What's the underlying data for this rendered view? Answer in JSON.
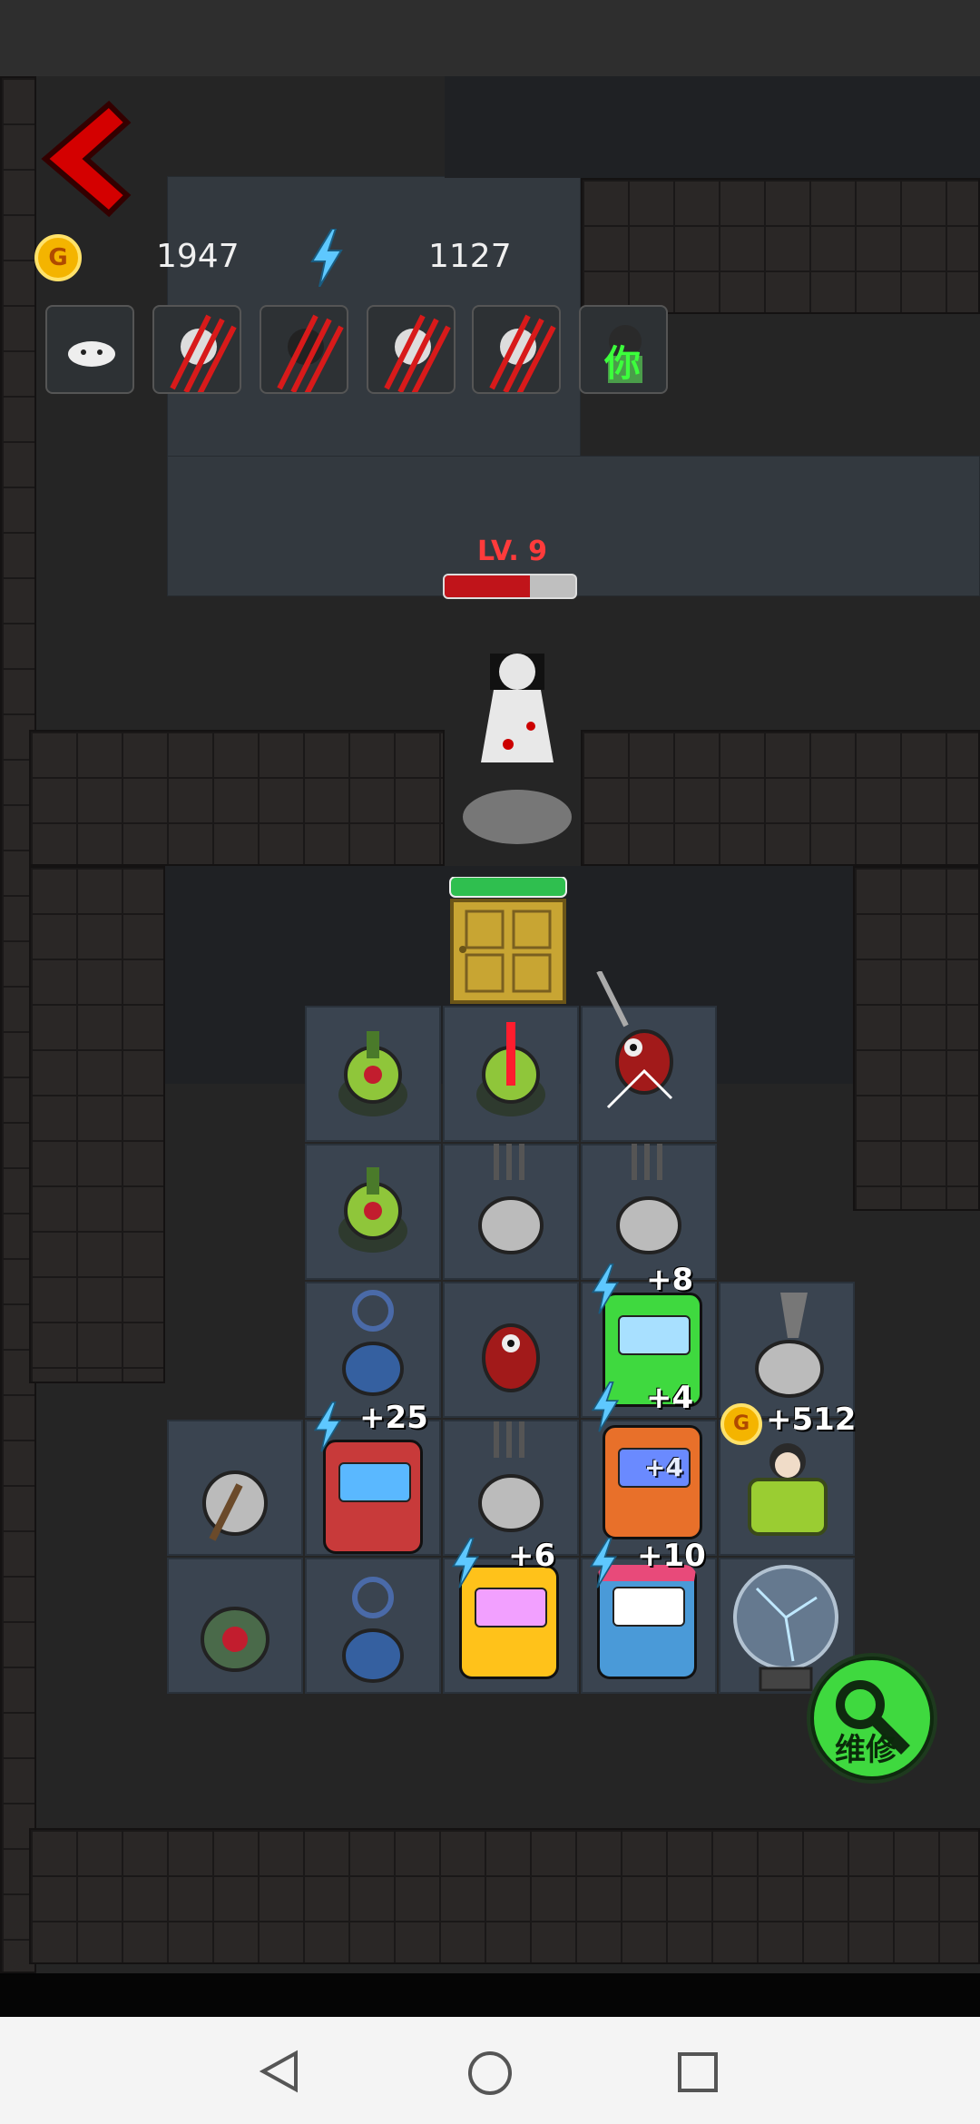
{
  "hud": {
    "coins_icon": "coin-icon",
    "coins": "1947",
    "energy_icon": "lightning-icon",
    "energy": "1127"
  },
  "players": [
    {
      "icon": "ghost-face-icon",
      "state": "alive"
    },
    {
      "icon": "player-avatar-icon",
      "state": "clawed"
    },
    {
      "icon": "player-avatar-icon",
      "state": "clawed"
    },
    {
      "icon": "player-avatar-icon",
      "state": "clawed"
    },
    {
      "icon": "player-avatar-icon",
      "state": "clawed"
    },
    {
      "icon": "player-avatar-icon",
      "state": "you",
      "label": "你"
    }
  ],
  "enemy": {
    "level_label": "LV. 9",
    "hp_fraction": 0.65
  },
  "tiles": {
    "badge_gamepad": "+8",
    "badge_arcade_red": "+25",
    "badge_arcade_orange": "+4",
    "badge_arcade_orange_inner": "+4",
    "badge_bed_coin": "+512",
    "badge_arcade_yellow": "+6",
    "badge_arcade_pink": "+10"
  },
  "colors": {
    "hp_red": "#c0141a",
    "back_red": "#d40000",
    "repair_green": "#3fd93f",
    "door_gold": "#c8a533",
    "door_bar_green": "#2fbf4f"
  },
  "repair_button": {
    "label": "维修",
    "icon": "gear-wrench-icon"
  },
  "navigation": {
    "back_icon": "triangle-back-icon",
    "home_icon": "circle-home-icon",
    "recents_icon": "square-recents-icon"
  }
}
